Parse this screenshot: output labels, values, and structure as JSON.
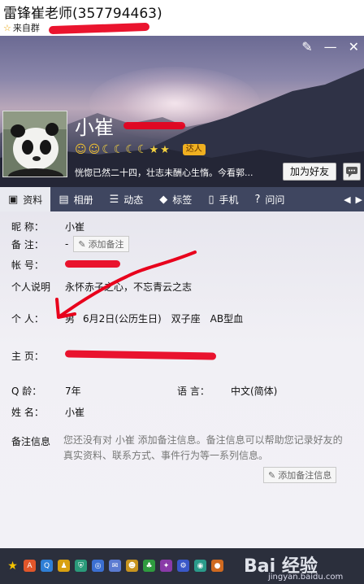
{
  "window": {
    "title": "雷锋崔老师(357794463)",
    "source_label": "来自群",
    "controls": [
      "✎",
      "—",
      "✕"
    ]
  },
  "profile": {
    "nickname": "小崔",
    "vip_badge": "达人",
    "signature": "恍惚已然二十四，壮志未酬心生惰。今看郭...",
    "add_friend_label": "加为好友"
  },
  "tabs": [
    {
      "label": "资料",
      "icon": "profile-icon"
    },
    {
      "label": "相册",
      "icon": "photo-icon"
    },
    {
      "label": "动态",
      "icon": "feed-icon"
    },
    {
      "label": "标签",
      "icon": "tag-icon"
    },
    {
      "label": "手机",
      "icon": "phone-icon"
    },
    {
      "label": "问问",
      "icon": "question-icon"
    }
  ],
  "info": {
    "nickname_label": "昵 称：",
    "nickname_value": "小崔",
    "note_label": "备 注：",
    "note_value": "-",
    "add_note_label": "添加备注",
    "account_label": "帐 号：",
    "description_label": "个人说明",
    "description_value": "永怀赤子之心，不忘青云之志",
    "personal_label": "个 人：",
    "personal_values": [
      "男",
      "6月2日(公历生日)",
      "双子座",
      "AB型血"
    ],
    "homepage_label": "主 页：",
    "qage_label": "Q 龄：",
    "qage_value": "7年",
    "language_label": "语 言：",
    "language_value": "中文(简体)",
    "name_label": "姓 名：",
    "name_value": "小崔",
    "remark_info_label": "备注信息",
    "remark_info_text": "您还没有对 小崔 添加备注信息。备注信息可以帮助您记录好友的真实资料、联系方式、事件行为等一系列信息。",
    "add_note_label_2": "添加备注信息"
  },
  "watermark": {
    "brand": "Bai 经验",
    "url": "jingyan.baidu.com"
  }
}
